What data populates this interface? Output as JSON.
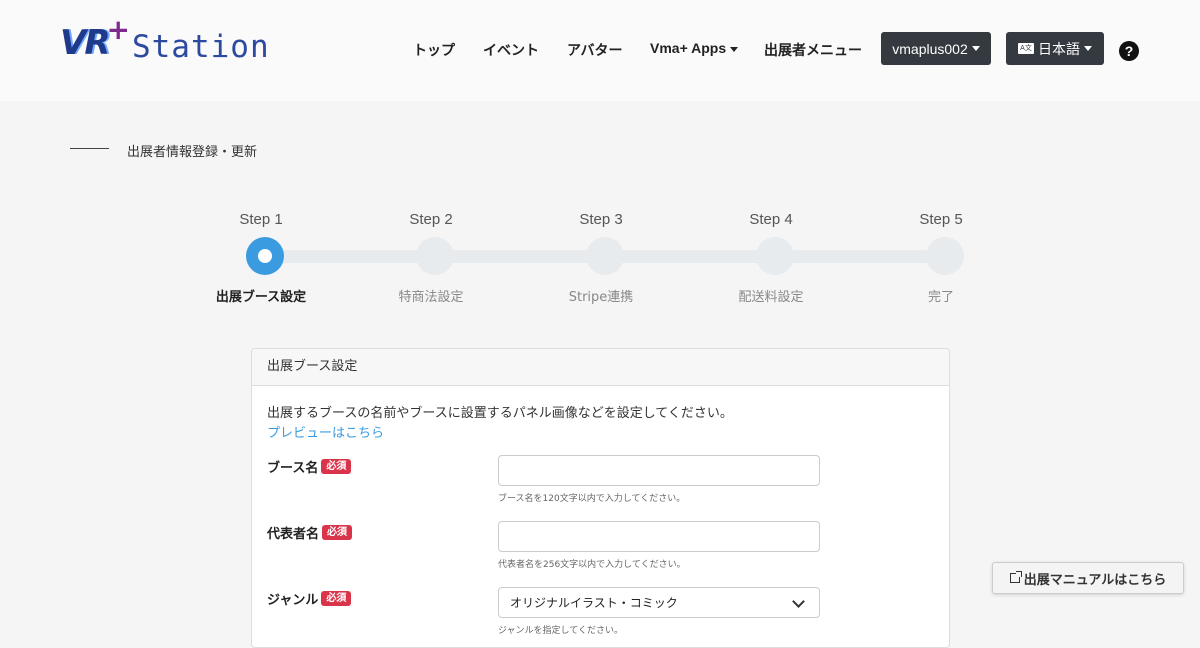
{
  "header": {
    "logo_primary": "VR",
    "logo_plus": "+",
    "logo_secondary": "Station",
    "nav": [
      {
        "label": "トップ"
      },
      {
        "label": "イベント"
      },
      {
        "label": "アバター"
      },
      {
        "label": "Vma+ Apps"
      },
      {
        "label": "出展者メニュー"
      }
    ],
    "user_label": "vmaplus002",
    "lang_icon_text": "A文",
    "lang_label": "日本語",
    "help_symbol": "?"
  },
  "section": {
    "title": "出展者情報登録・更新"
  },
  "steps": [
    {
      "step": "Step 1",
      "name": "出展ブース設定",
      "active": true
    },
    {
      "step": "Step 2",
      "name": "特商法設定",
      "active": false
    },
    {
      "step": "Step 3",
      "name": "Stripe連携",
      "active": false
    },
    {
      "step": "Step 4",
      "name": "配送料設定",
      "active": false
    },
    {
      "step": "Step 5",
      "name": "完了",
      "active": false
    }
  ],
  "card": {
    "title": "出展ブース設定",
    "description": "出展するブースの名前やブースに設置するパネル画像などを設定してください。",
    "preview_link": "プレビューはこちら",
    "required_badge": "必須",
    "fields": [
      {
        "label": "ブース名",
        "value": "",
        "hint": "ブース名を120文字以内で入力してください。"
      },
      {
        "label": "代表者名",
        "value": "",
        "hint": "代表者名を256文字以内で入力してください。"
      },
      {
        "label": "ジャンル",
        "value": "オリジナルイラスト・コミック",
        "hint": "ジャンルを指定してください。"
      }
    ]
  },
  "manual_button": {
    "label": "出展マニュアルはこちら"
  },
  "colors": {
    "accent": "#3b9be0",
    "required": "#d9344a",
    "dark_button": "#343a40"
  }
}
